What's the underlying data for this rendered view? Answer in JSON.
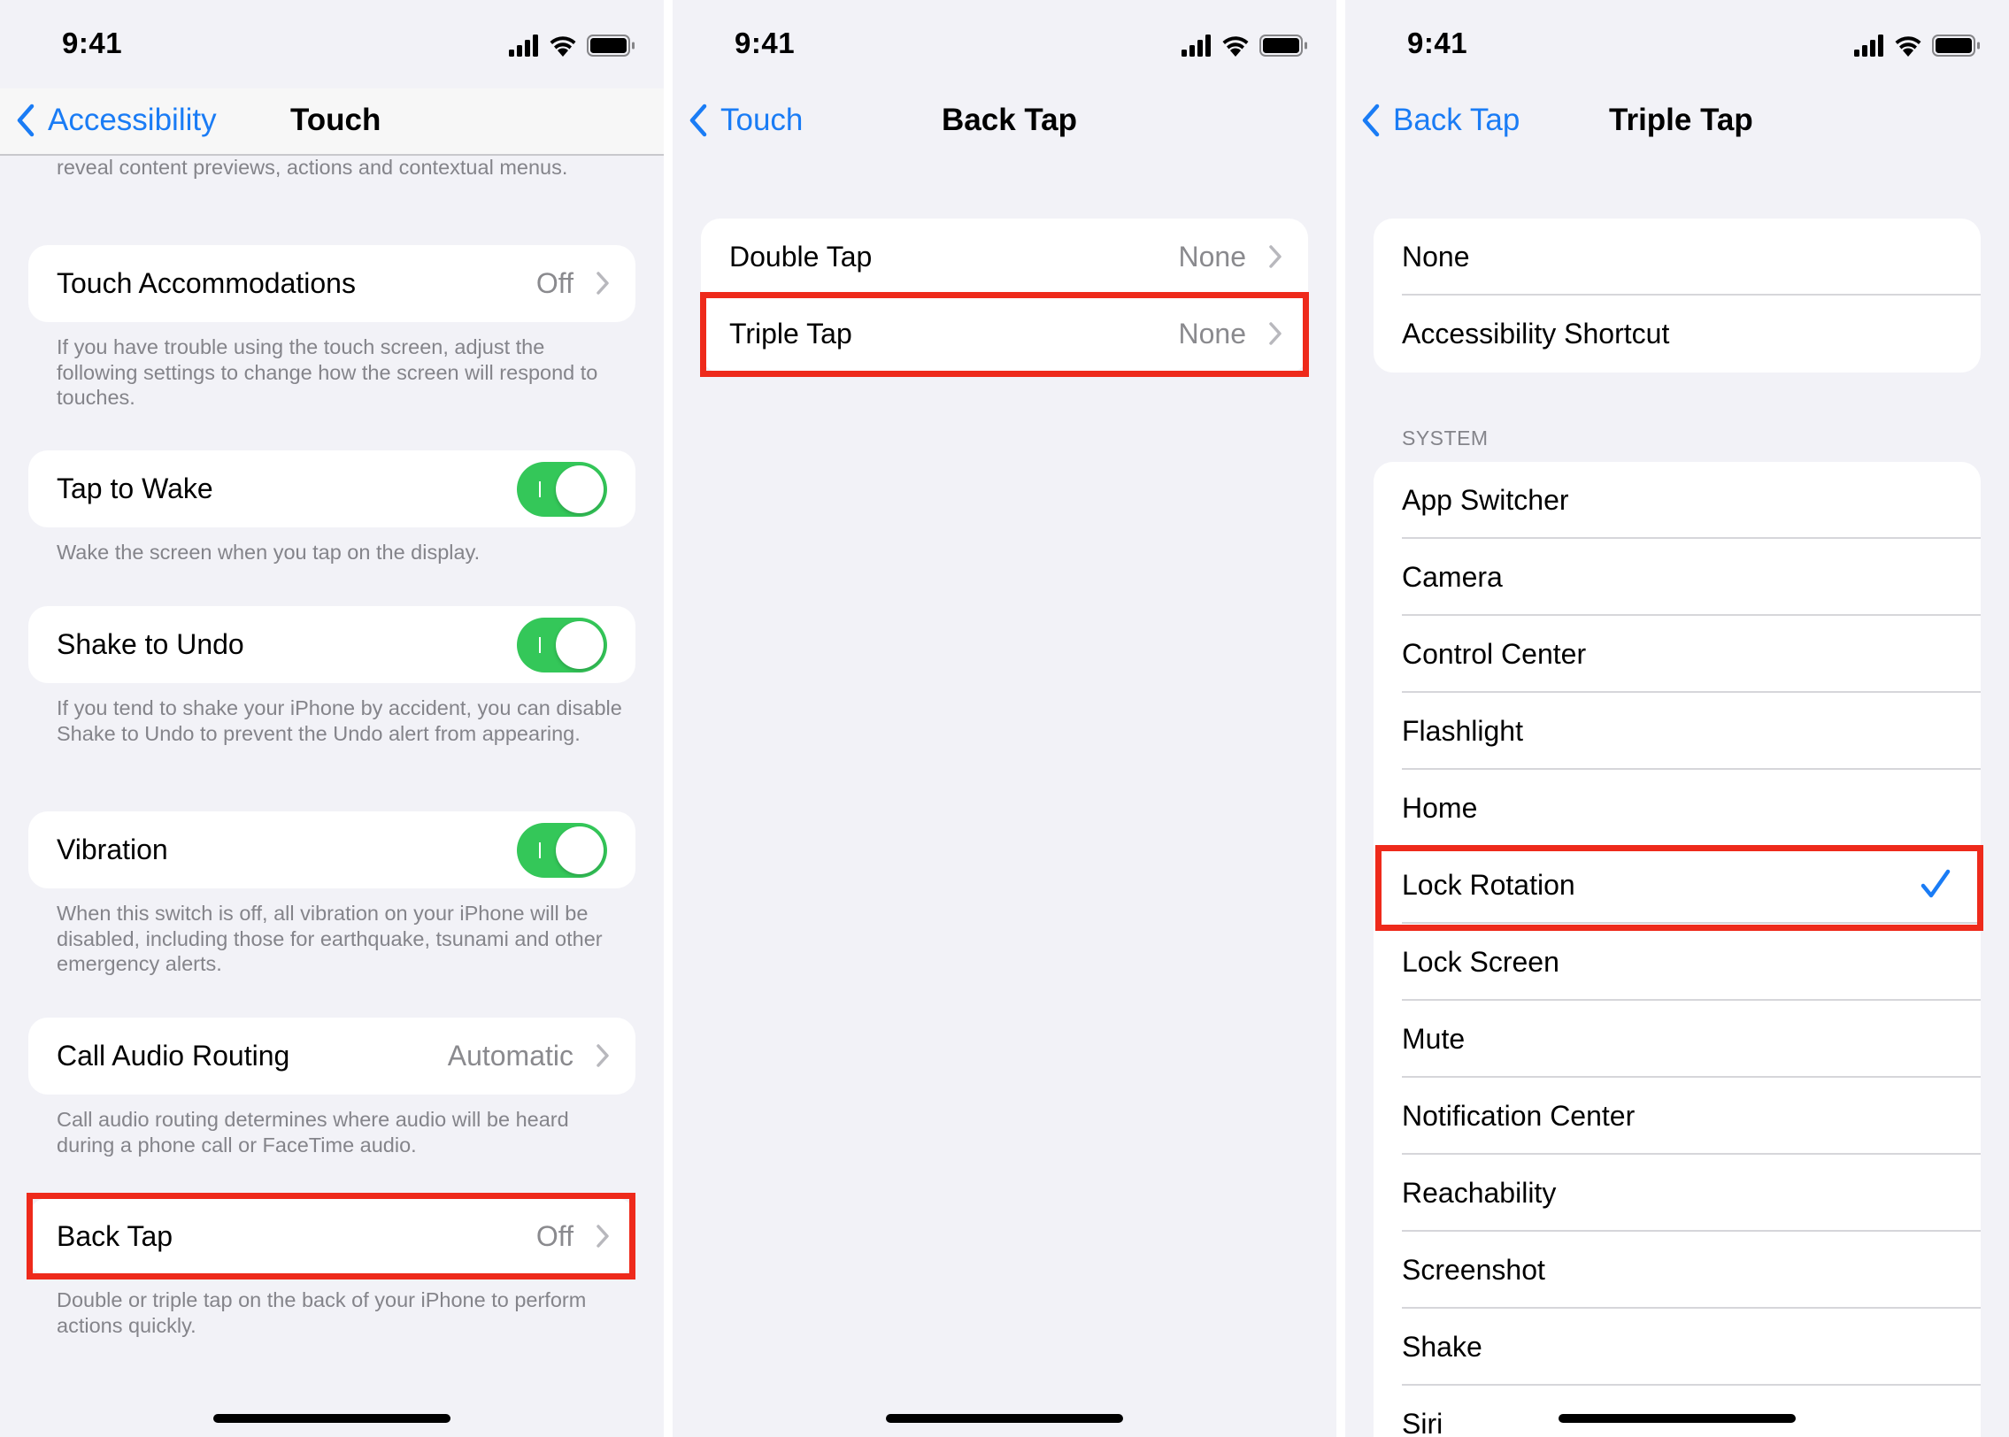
{
  "screens": [
    {
      "status_time": "9:41",
      "nav": {
        "back_label": "Accessibility",
        "title": "Touch"
      },
      "top_note": "reveal content previews, actions and contextual menus.",
      "sections": [
        {
          "label": "Touch Accommodations",
          "value": "Off",
          "footer": "If you have trouble using the touch screen, adjust the following settings to change how the screen will respond to touches."
        },
        {
          "label": "Tap to Wake",
          "toggle_on": true,
          "footer": "Wake the screen when you tap on the display."
        },
        {
          "label": "Shake to Undo",
          "toggle_on": true,
          "footer": "If you tend to shake your iPhone by accident, you can disable Shake to Undo to prevent the Undo alert from appearing."
        },
        {
          "label": "Vibration",
          "toggle_on": true,
          "footer": "When this switch is off, all vibration on your iPhone will be disabled, including those for earthquake, tsunami and other emergency alerts."
        },
        {
          "label": "Call Audio Routing",
          "value": "Automatic",
          "footer": "Call audio routing determines where audio will be heard during a phone call or FaceTime audio."
        },
        {
          "label": "Back Tap",
          "value": "Off",
          "footer": "Double or triple tap on the back of your iPhone to perform actions quickly."
        }
      ]
    },
    {
      "status_time": "9:41",
      "nav": {
        "back_label": "Touch",
        "title": "Back Tap"
      },
      "rows": [
        {
          "label": "Double Tap",
          "value": "None"
        },
        {
          "label": "Triple Tap",
          "value": "None"
        }
      ]
    },
    {
      "status_time": "9:41",
      "nav": {
        "back_label": "Back Tap",
        "title": "Triple Tap"
      },
      "top_rows": [
        "None",
        "Accessibility Shortcut"
      ],
      "system_header": "SYSTEM",
      "system_rows": [
        "App Switcher",
        "Camera",
        "Control Center",
        "Flashlight",
        "Home",
        "Lock Rotation",
        "Lock Screen",
        "Mute",
        "Notification Center",
        "Reachability",
        "Screenshot",
        "Shake",
        "Siri"
      ],
      "selected": "Lock Rotation"
    }
  ],
  "colors": {
    "accent": "#1a7cf5",
    "toggle_on": "#34c759",
    "highlight": "#ee2a1b",
    "background": "#f2f2f7"
  }
}
